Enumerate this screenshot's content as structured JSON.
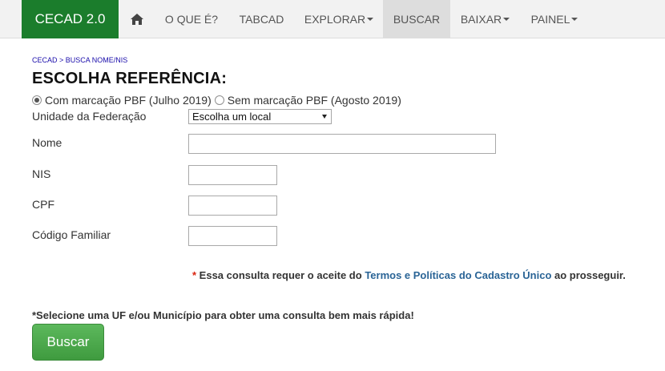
{
  "navbar": {
    "brand": "CECAD 2.0",
    "home_icon": "home-icon",
    "items": [
      {
        "label": "O QUE É?",
        "dropdown": false
      },
      {
        "label": "TABCAD",
        "dropdown": false
      },
      {
        "label": "EXPLORAR",
        "dropdown": true
      },
      {
        "label": "BUSCAR",
        "dropdown": false,
        "active": true
      },
      {
        "label": "BAIXAR",
        "dropdown": true
      },
      {
        "label": "PAINEL",
        "dropdown": true
      }
    ]
  },
  "breadcrumb": "CECAD > BUSCA NOME/NIS",
  "title": "ESCOLHA REFERÊNCIA:",
  "reference": {
    "option1": "Com marcação PBF (Julho 2019)",
    "option2": "Sem marcação PBF (Agosto 2019)",
    "selected": "option1"
  },
  "form": {
    "uf_label": "Unidade da Federação",
    "uf_value": "Escolha um local",
    "nome_label": "Nome",
    "nome_value": "",
    "nis_label": "NIS",
    "nis_value": "",
    "cpf_label": "CPF",
    "cpf_value": "",
    "codigo_label": "Código Familiar",
    "codigo_value": ""
  },
  "notice": {
    "star": "*",
    "before": " Essa consulta requer o aceite do ",
    "link": "Termos e Políticas do Cadastro Único",
    "after": " ao prosseguir."
  },
  "hint": "*Selecione uma UF e/ou Município para obter uma consulta bem mais rápida!",
  "button": "Buscar",
  "colors": {
    "brand": "#1b7d2c",
    "navbar": "#f2f2f2",
    "active_nav": "#dddddd",
    "link": "#2a6496",
    "required_star": "#d9230f",
    "button": "#4cae4c"
  }
}
